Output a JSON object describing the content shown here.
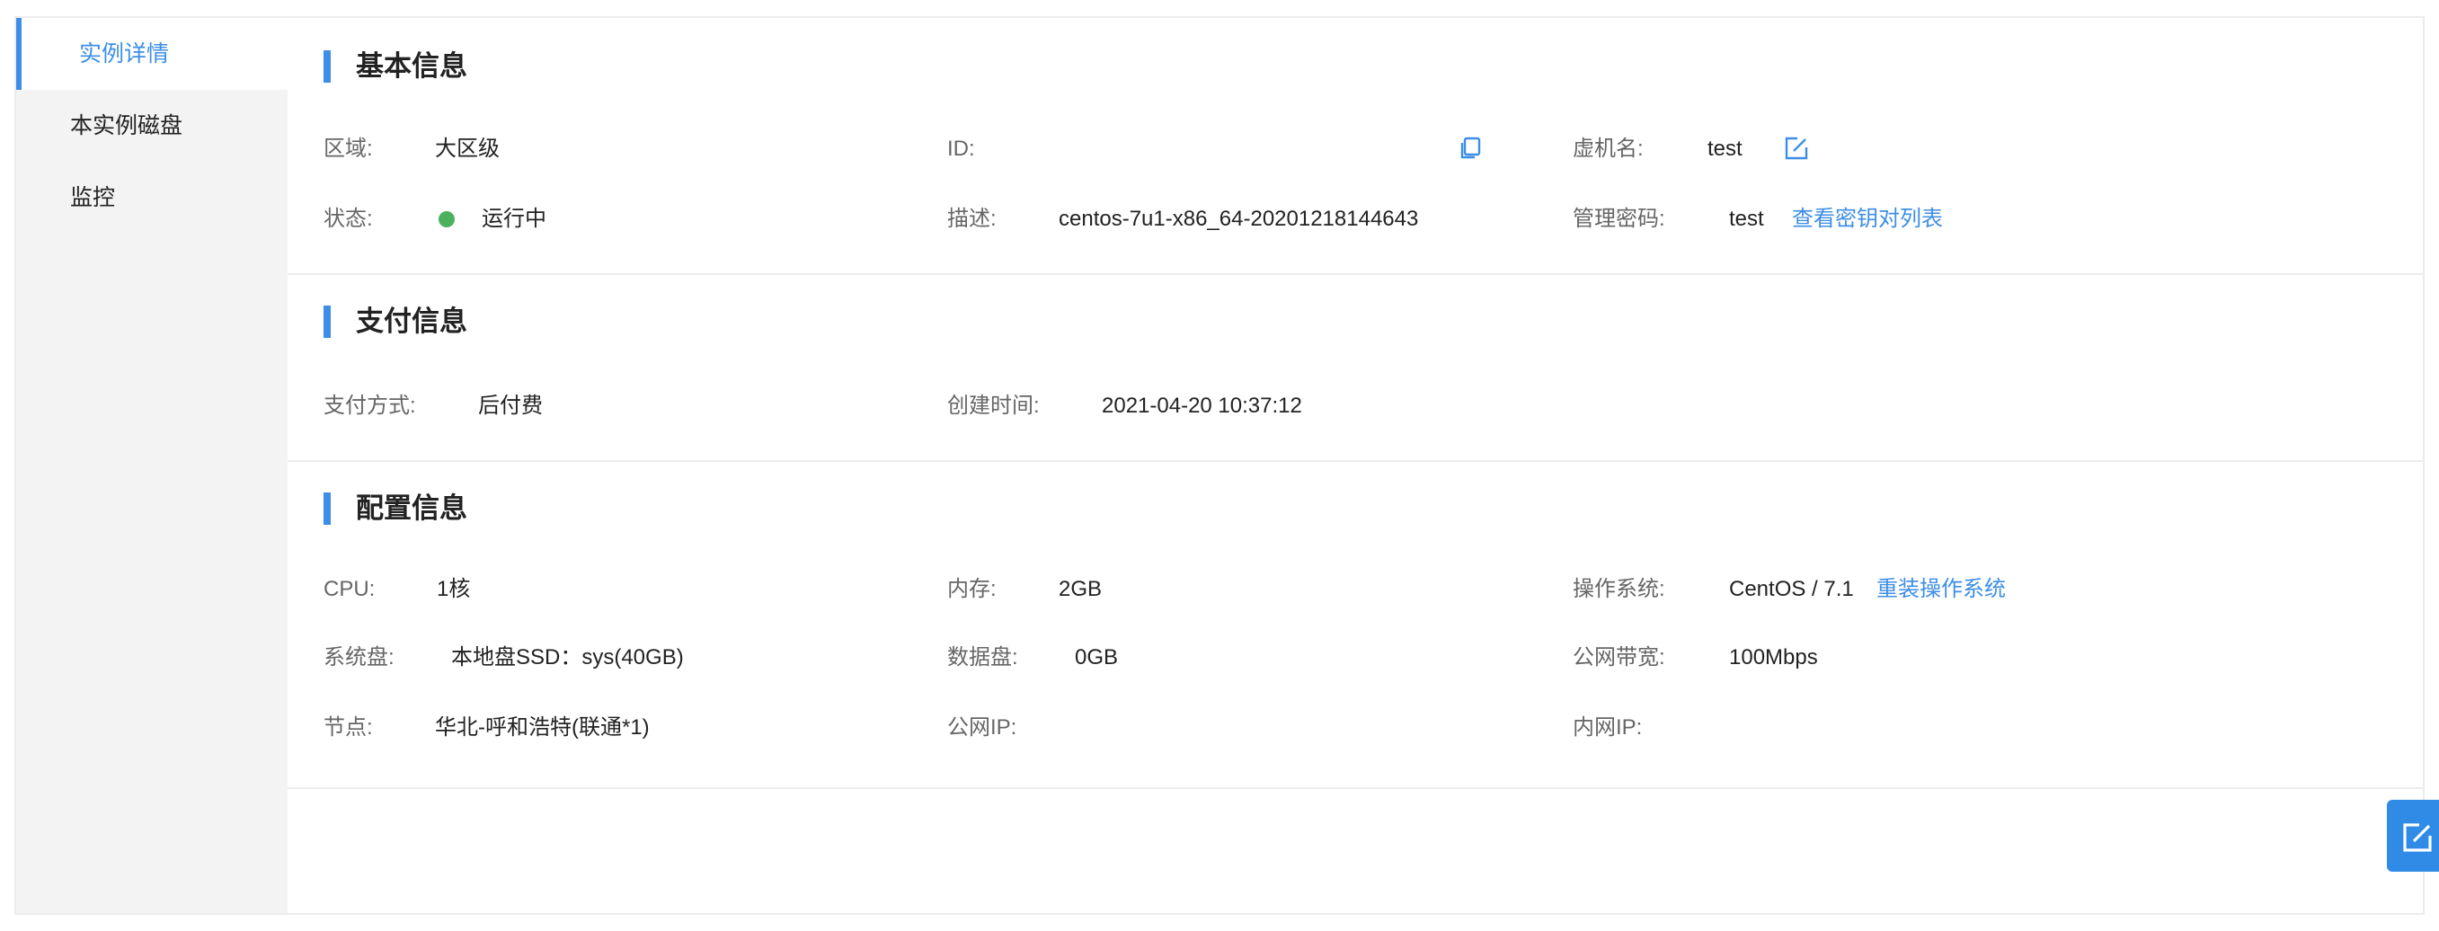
{
  "sidebar": {
    "items": [
      {
        "label": "实例详情",
        "active": true
      },
      {
        "label": "本实例磁盘",
        "active": false
      },
      {
        "label": "监控",
        "active": false
      }
    ]
  },
  "basic": {
    "title": "基本信息",
    "region_label": "区域:",
    "region_value": "大区级",
    "id_label": "ID:",
    "id_value": "",
    "vm_name_label": "虚机名:",
    "vm_name_value": "test",
    "status_label": "状态:",
    "status_value": "运行中",
    "desc_label": "描述:",
    "desc_value": "centos-7u1-x86_64-20201218144643",
    "password_label": "管理密码:",
    "password_value": "test",
    "keypair_link": "查看密钥对列表"
  },
  "payment": {
    "title": "支付信息",
    "method_label": "支付方式:",
    "method_value": "后付费",
    "created_label": "创建时间:",
    "created_value": "2021-04-20 10:37:12"
  },
  "config": {
    "title": "配置信息",
    "cpu_label": "CPU:",
    "cpu_value": "1核",
    "memory_label": "内存:",
    "memory_value": "2GB",
    "os_label": "操作系统:",
    "os_value": "CentOS / 7.1",
    "reinstall_link": "重装操作系统",
    "sysdisk_label": "系统盘:",
    "sysdisk_value": "本地盘SSD：sys(40GB)",
    "datadisk_label": "数据盘:",
    "datadisk_value": "0GB",
    "bandwidth_label": "公网带宽:",
    "bandwidth_value": "100Mbps",
    "node_label": "节点:",
    "node_value": "华北-呼和浩特(联通*1)",
    "public_ip_label": "公网IP:",
    "public_ip_value": "",
    "private_ip_label": "内网IP:",
    "private_ip_value": ""
  },
  "colors": {
    "accent": "#3d8ee6",
    "status_running": "#4cb15e",
    "sidebar_bg": "#f3f3f3"
  },
  "icons": {
    "copy": "copy-icon",
    "edit": "edit-icon",
    "float": "edit-icon"
  }
}
